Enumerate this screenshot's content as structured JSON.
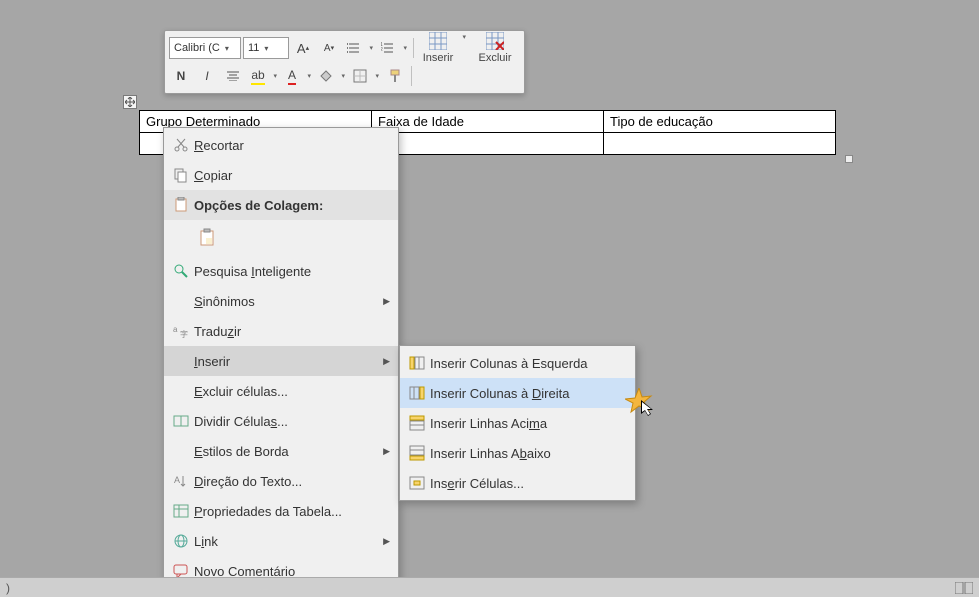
{
  "toolbar": {
    "font_name": "Calibri (C",
    "font_size": "11",
    "bold": "N",
    "italic": "I",
    "font_color_letter": "A",
    "highlight_letter": "ab",
    "insert_label": "Inserir",
    "delete_label": "Excluir",
    "grow_font": "A",
    "shrink_font": "A",
    "styles_letter": "A"
  },
  "table": {
    "headers": [
      "Grupo Determinado",
      "Faixa de Idade",
      "Tipo de educação"
    ],
    "rows": [
      [
        "",
        "",
        ""
      ]
    ]
  },
  "menu": {
    "cut": "Recortar",
    "copy": "Copiar",
    "paste_options": "Opções de Colagem:",
    "smart_lookup": "Pesquisa Inteligente",
    "synonyms": "Sinônimos",
    "translate": "Traduzir",
    "insert": "Inserir",
    "delete_cells": "Excluir células...",
    "split_cells": "Dividir Células...",
    "border_styles": "Estilos de Borda",
    "text_direction": "Direção do Texto...",
    "table_properties": "Propriedades da Tabela...",
    "link": "Link",
    "new_comment": "Novo Comentário"
  },
  "submenu": {
    "insert_cols_left": "Inserir Colunas à Esquerda",
    "insert_cols_right": "Inserir Colunas à Direita",
    "insert_rows_above": "Inserir Linhas Acima",
    "insert_rows_below": "Inserir Linhas Abaixo",
    "insert_cells": "Inserir Células..."
  },
  "status": {
    "left_indicator": ")"
  }
}
